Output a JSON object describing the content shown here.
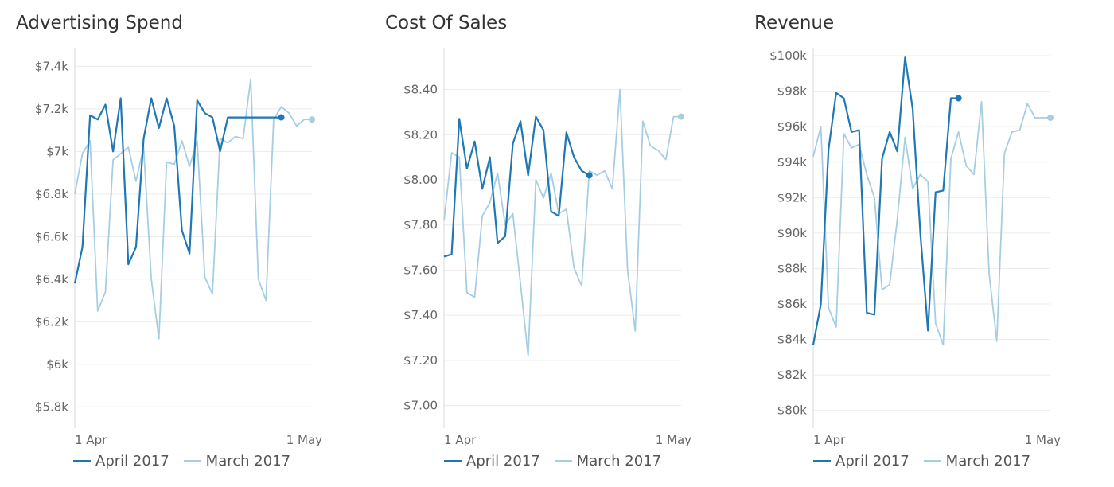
{
  "colors": {
    "april": "#1f78b4",
    "march": "#a6cee3",
    "grid": "#ececec",
    "axis": "#d8d8d8"
  },
  "legend": [
    {
      "label": "April 2017",
      "color": "#1f78b4"
    },
    {
      "label": "March 2017",
      "color": "#a6cee3"
    }
  ],
  "chart_data": [
    {
      "type": "line",
      "title": "Advertising Spend",
      "xlabel": "",
      "ylabel": "",
      "ylim": [
        5700,
        7450
      ],
      "y_ticks": [
        5800,
        6000,
        6200,
        6400,
        6600,
        6800,
        7000,
        7200,
        7400
      ],
      "y_tick_labels": [
        "$5.8k",
        "$6k",
        "$6.2k",
        "$6.4k",
        "$6.6k",
        "$6.8k",
        "$7k",
        "$7.2k",
        "$7.4k"
      ],
      "x_range": [
        1,
        32
      ],
      "x_ticks": [
        1,
        31
      ],
      "x_tick_labels": [
        "1 Apr",
        "1 May"
      ],
      "grid": true,
      "legend_position": "bottom-left",
      "series": [
        {
          "name": "April 2017",
          "color": "#1f78b4",
          "end_marker": true,
          "x": [
            1,
            2,
            3,
            4,
            5,
            6,
            7,
            8,
            9,
            10,
            11,
            12,
            13,
            14,
            15,
            16,
            17,
            18,
            19,
            20,
            21,
            22,
            23,
            24,
            25,
            26,
            27,
            28
          ],
          "y": [
            6380,
            6550,
            7170,
            7150,
            7220,
            7000,
            7250,
            6470,
            6550,
            7060,
            7250,
            7110,
            7250,
            7120,
            6630,
            6520,
            7240,
            7180,
            7160,
            7000,
            7160,
            7160,
            7160,
            7160,
            7160,
            7160,
            7160,
            7160
          ]
        },
        {
          "name": "March 2017",
          "color": "#a6cee3",
          "end_marker": true,
          "x": [
            1,
            2,
            3,
            4,
            5,
            6,
            7,
            8,
            9,
            10,
            11,
            12,
            13,
            14,
            15,
            16,
            17,
            18,
            19,
            20,
            21,
            22,
            23,
            24,
            25,
            26,
            27,
            28,
            29,
            30,
            31,
            32
          ],
          "y": [
            6800,
            6990,
            7050,
            6250,
            6340,
            6960,
            6990,
            7020,
            6860,
            7020,
            6400,
            6120,
            6950,
            6940,
            7050,
            6930,
            7050,
            6410,
            6330,
            7060,
            7040,
            7070,
            7060,
            7340,
            6400,
            6300,
            7150,
            7210,
            7180,
            7120,
            7150,
            7150
          ]
        }
      ]
    },
    {
      "type": "line",
      "title": "Cost Of Sales",
      "xlabel": "",
      "ylabel": "",
      "ylim": [
        6.9,
        8.55
      ],
      "y_ticks": [
        7.0,
        7.2,
        7.4,
        7.6,
        7.8,
        8.0,
        8.2,
        8.4
      ],
      "y_tick_labels": [
        "$7.00",
        "$7.20",
        "$7.40",
        "$7.60",
        "$7.80",
        "$8.00",
        "$8.20",
        "$8.40"
      ],
      "x_range": [
        1,
        32
      ],
      "x_ticks": [
        1,
        31
      ],
      "x_tick_labels": [
        "1 Apr",
        "1 May"
      ],
      "grid": true,
      "legend_position": "bottom-left",
      "series": [
        {
          "name": "April 2017",
          "color": "#1f78b4",
          "end_marker": true,
          "x": [
            1,
            2,
            3,
            4,
            5,
            6,
            7,
            8,
            9,
            10,
            11,
            12,
            13,
            14,
            15,
            16,
            17,
            18,
            19,
            20
          ],
          "y": [
            7.66,
            7.67,
            8.27,
            8.05,
            8.17,
            7.96,
            8.1,
            7.72,
            7.75,
            8.16,
            8.26,
            8.02,
            8.28,
            8.22,
            7.86,
            7.84,
            8.21,
            8.1,
            8.04,
            8.02
          ]
        },
        {
          "name": "March 2017",
          "color": "#a6cee3",
          "end_marker": true,
          "x": [
            1,
            2,
            3,
            4,
            5,
            6,
            7,
            8,
            9,
            10,
            11,
            12,
            13,
            14,
            15,
            16,
            17,
            18,
            19,
            20,
            21,
            22,
            23,
            24,
            25,
            26,
            27,
            28,
            29,
            30,
            31,
            32
          ],
          "y": [
            7.82,
            8.12,
            8.1,
            7.5,
            7.48,
            7.84,
            7.9,
            8.03,
            7.8,
            7.85,
            7.54,
            7.22,
            8.0,
            7.92,
            8.03,
            7.85,
            7.87,
            7.61,
            7.53,
            8.04,
            8.02,
            8.04,
            7.96,
            8.4,
            7.6,
            7.33,
            8.26,
            8.15,
            8.13,
            8.09,
            8.28,
            8.28
          ]
        }
      ]
    },
    {
      "type": "line",
      "title": "Revenue",
      "xlabel": "",
      "ylabel": "",
      "ylim": [
        79000,
        100000
      ],
      "y_ticks": [
        80000,
        82000,
        84000,
        86000,
        88000,
        90000,
        92000,
        94000,
        96000,
        98000,
        100000
      ],
      "y_tick_labels": [
        "$80k",
        "$82k",
        "$84k",
        "$86k",
        "$88k",
        "$90k",
        "$92k",
        "$94k",
        "$96k",
        "$98k",
        "$100k"
      ],
      "x_range": [
        1,
        32
      ],
      "x_ticks": [
        1,
        31
      ],
      "x_tick_labels": [
        "1 Apr",
        "1 May"
      ],
      "grid": true,
      "legend_position": "bottom-left",
      "series": [
        {
          "name": "April 2017",
          "color": "#1f78b4",
          "end_marker": true,
          "x": [
            1,
            2,
            3,
            4,
            5,
            6,
            7,
            8,
            9,
            10,
            11,
            12,
            13,
            14,
            15,
            16,
            17,
            18,
            19,
            20
          ],
          "y": [
            83700,
            86000,
            94700,
            97900,
            97600,
            95700,
            95800,
            85500,
            85400,
            94200,
            95700,
            94600,
            99900,
            97000,
            90000,
            84500,
            92300,
            92400,
            97600,
            97600
          ]
        },
        {
          "name": "March 2017",
          "color": "#a6cee3",
          "end_marker": true,
          "x": [
            1,
            2,
            3,
            4,
            5,
            6,
            7,
            8,
            9,
            10,
            11,
            12,
            13,
            14,
            15,
            16,
            17,
            18,
            19,
            20,
            21,
            22,
            23,
            24,
            25,
            26,
            27,
            28,
            29,
            30,
            31,
            32
          ],
          "y": [
            94300,
            96000,
            85800,
            84700,
            95600,
            94800,
            95000,
            93300,
            92000,
            86800,
            87100,
            90800,
            95400,
            92500,
            93300,
            92900,
            84900,
            83700,
            94200,
            95700,
            93800,
            93300,
            97400,
            87700,
            83900,
            94500,
            95700,
            95800,
            97300,
            96500,
            96500,
            96500
          ]
        }
      ]
    }
  ]
}
